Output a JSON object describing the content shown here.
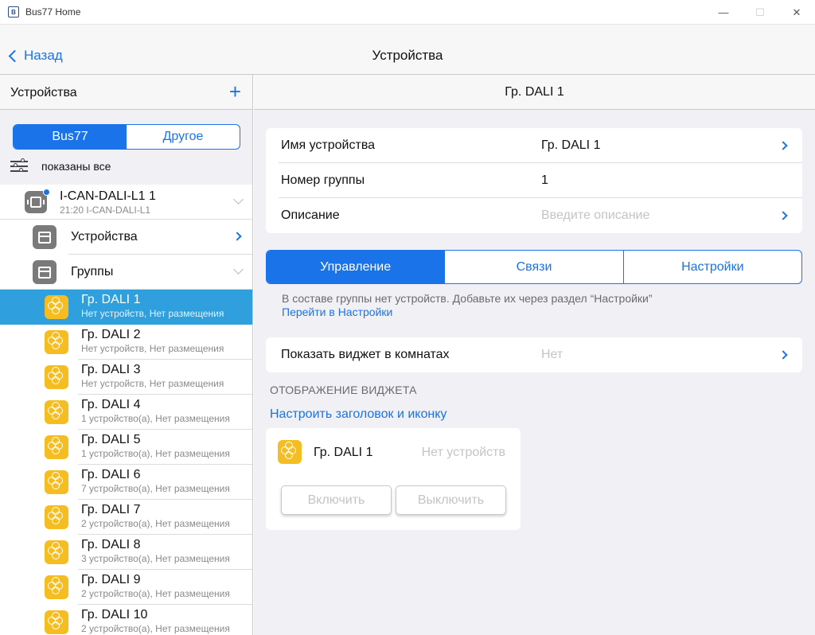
{
  "window": {
    "title": "Bus77 Home",
    "icon_letter": "B"
  },
  "navbar": {
    "back_label": "Назад",
    "title": "Устройства"
  },
  "sidebar": {
    "title": "Устройства",
    "add_label": "+",
    "segments": [
      "Bus77",
      "Другое"
    ],
    "active_segment": 0,
    "filter_label": "показаны все",
    "controller": {
      "title": "I-CAN-DALI-L1 1",
      "subtitle": "21:20 I-CAN-DALI-L1"
    },
    "folders": [
      {
        "label": "Устройства"
      },
      {
        "label": "Группы"
      }
    ],
    "groups": [
      {
        "title": "Гр. DALI 1",
        "subtitle": "Нет устройств, Нет размещения",
        "selected": true
      },
      {
        "title": "Гр. DALI 2",
        "subtitle": "Нет устройств, Нет размещения"
      },
      {
        "title": "Гр. DALI 3",
        "subtitle": "Нет устройств, Нет размещения"
      },
      {
        "title": "Гр. DALI 4",
        "subtitle": "1 устройство(а), Нет размещения"
      },
      {
        "title": "Гр. DALI 5",
        "subtitle": "1 устройство(а), Нет размещения"
      },
      {
        "title": "Гр. DALI 6",
        "subtitle": "7 устройство(а), Нет размещения"
      },
      {
        "title": "Гр. DALI 7",
        "subtitle": "2 устройство(а), Нет размещения"
      },
      {
        "title": "Гр. DALI 8",
        "subtitle": "3 устройство(а), Нет размещения"
      },
      {
        "title": "Гр. DALI 9",
        "subtitle": "2 устройство(а), Нет размещения"
      },
      {
        "title": "Гр. DALI 10",
        "subtitle": "2 устройство(а), Нет размещения"
      }
    ]
  },
  "detail": {
    "title": "Гр. DALI 1",
    "props": [
      {
        "label": "Имя устройства",
        "value": "Гр. DALI 1"
      },
      {
        "label": "Номер группы",
        "value": "1"
      },
      {
        "label": "Описание",
        "placeholder": "Введите описание"
      }
    ],
    "tabs": [
      "Управление",
      "Связи",
      "Настройки"
    ],
    "active_tab": 0,
    "hint": "В составе группы нет устройств. Добавьте их через раздел “Настройки”",
    "hint_link": "Перейти в Настройки",
    "show_widget": {
      "label": "Показать виджет в комнатах",
      "value": "Нет"
    },
    "section_caption": "ОТОБРАЖЕНИЕ ВИДЖЕТА",
    "config_link": "Настроить заголовок и иконку",
    "widget": {
      "title": "Гр. DALI 1",
      "status": "Нет устройств",
      "on_label": "Включить",
      "off_label": "Выключить"
    }
  },
  "colors": {
    "accent": "#1a73e8",
    "selection": "#2f9fde",
    "dali": "#f5bd1f",
    "device_icon": "#7a7a7a"
  }
}
